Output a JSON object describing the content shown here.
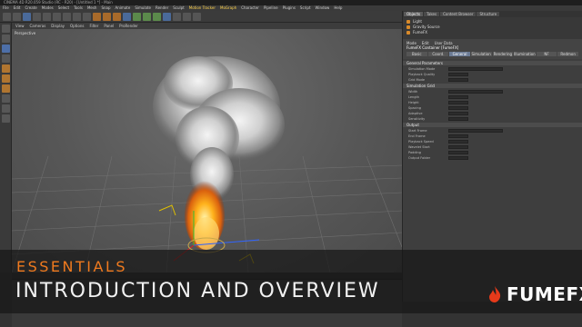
{
  "window": {
    "title": "CINEMA 4D R20.059 Studio (RC - R20) - [Untitled 1 *] - Main"
  },
  "menus": [
    "File",
    "Edit",
    "Create",
    "Modes",
    "Select",
    "Tools",
    "Mesh",
    "Snap",
    "Animate",
    "Simulate",
    "Render",
    "Sculpt",
    "Motion Tracker",
    "MoGraph",
    "Character",
    "Pipeline",
    "Plugins",
    "Script",
    "Window",
    "Help"
  ],
  "viewport": {
    "menus": [
      "View",
      "Cameras",
      "Display",
      "Options",
      "Filter",
      "Panel",
      "ProRender"
    ],
    "label": "Perspective"
  },
  "objects": {
    "tabs": [
      "Objects",
      "Takes",
      "Content Browser",
      "Structure"
    ],
    "items": [
      "Light",
      "Gravity Source",
      "FumeFX"
    ]
  },
  "attributes": {
    "tabs": [
      "Mode",
      "Edit",
      "User Data"
    ],
    "object_title": "FumeFX Container [FumeFX]",
    "subtabs": [
      "Basic",
      "Coord.",
      "General",
      "Simulation",
      "Rendering",
      "Illumination",
      "NF",
      "Redmon"
    ],
    "active_subtab": "General",
    "sections": [
      {
        "title": "General Parameters",
        "rows": [
          {
            "label": "Simulation Mode"
          },
          {
            "label": "Playback Quality"
          },
          {
            "label": "Grid Mode"
          }
        ]
      },
      {
        "title": "Simulation Grid",
        "rows": [
          {
            "label": "Width"
          },
          {
            "label": "Length"
          },
          {
            "label": "Height"
          },
          {
            "label": "Spacing"
          },
          {
            "label": "Adaptive"
          },
          {
            "label": "Sensitivity"
          }
        ]
      },
      {
        "title": "Output",
        "rows": [
          {
            "label": "Start Frame"
          },
          {
            "label": "End Frame"
          },
          {
            "label": "Playback Speed"
          },
          {
            "label": "Wavelet Start"
          },
          {
            "label": "Padding"
          },
          {
            "label": "Output Folder"
          }
        ]
      }
    ]
  },
  "overlay": {
    "category": "ESSENTIALS",
    "title": "INTRODUCTION AND OVERVIEW",
    "logo_text": "FUMEFX"
  },
  "colors": {
    "accent": "#f07a1e",
    "title_text": "#f2f2f2"
  }
}
